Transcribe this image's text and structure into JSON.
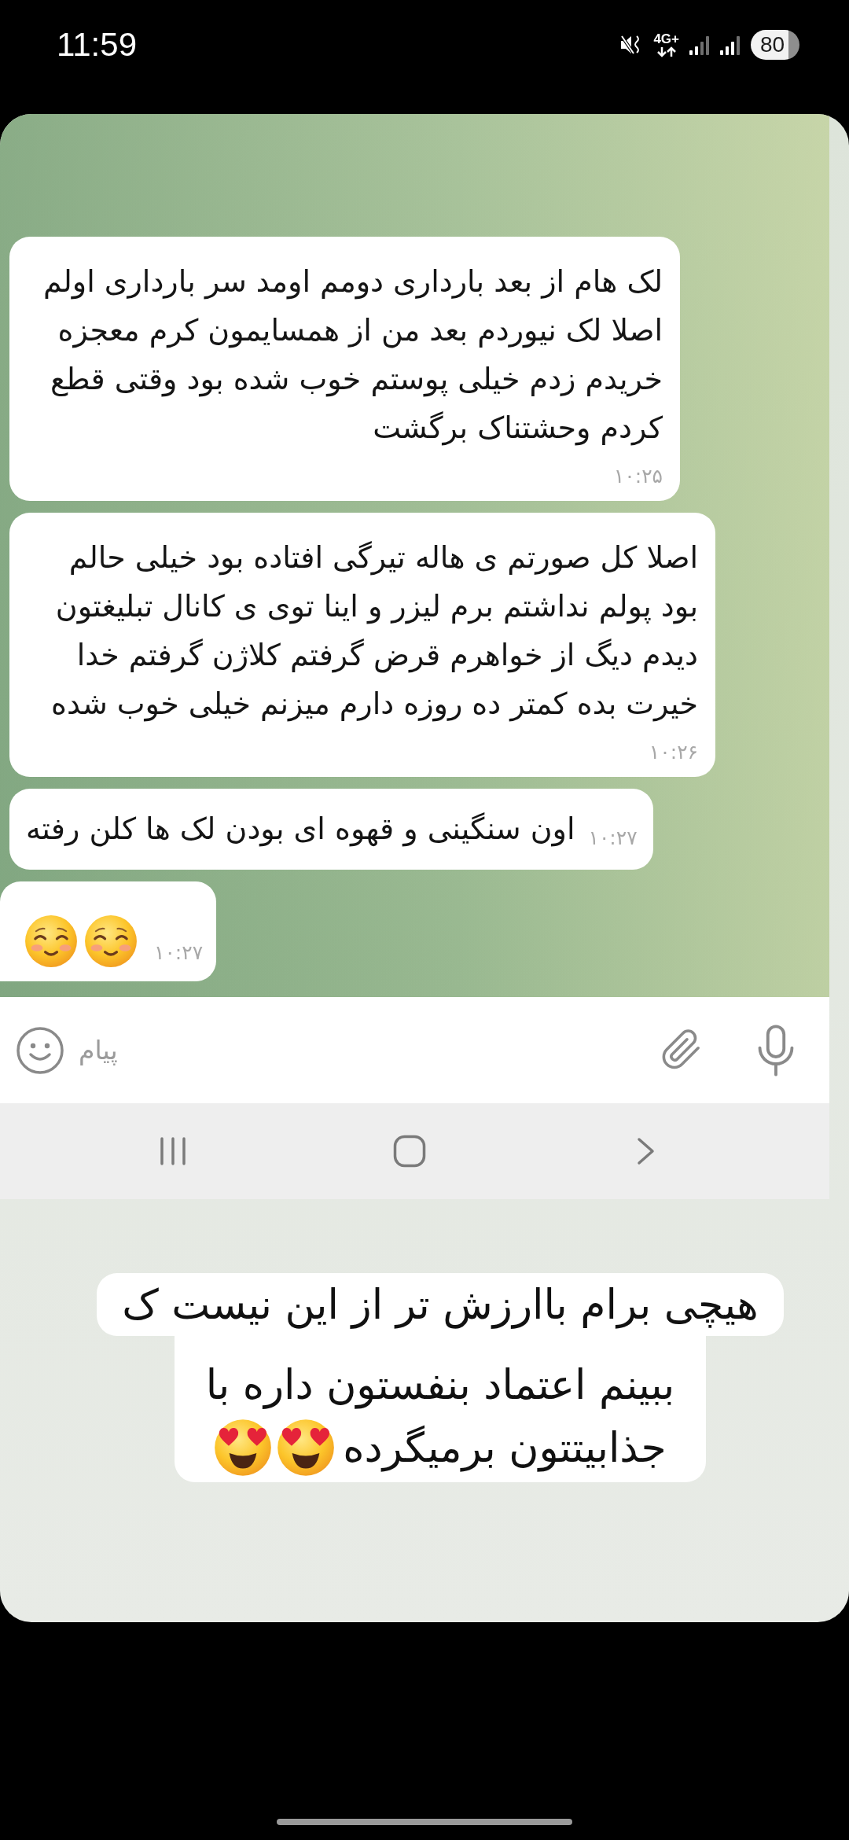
{
  "status_bar": {
    "time": "11:59",
    "network": "4G+",
    "battery": "80"
  },
  "chat": {
    "messages": [
      {
        "kind": "text",
        "text": "لک هام از بعد بارداری دومم اومد سر بارداری اولم اصلا لک نیوردم بعد من از همسایمون کرم معجزه خریدم زدم خیلی پوستم خوب شده بود وقتی قطع کردم وحشتناک برگشت",
        "time": "۱۰:۲۵",
        "tail": false
      },
      {
        "kind": "text",
        "text": "اصلا کل صورتم ی هاله تیرگی افتاده بود خیلی حالم بود پولم نداشتم برم لیزر و اینا توی ی کانال تبلیغتون دیدم دیگ از خواهرم قرض گرفتم کلاژن گرفتم خدا خیرت بده کمتر ده روزه دارم میزنم خیلی خوب شده",
        "time": "۱۰:۲۶",
        "tail": false
      },
      {
        "kind": "inline",
        "text": "اون سنگینی و قهوه ای بودن لک ها کلن رفته",
        "time": "۱۰:۲۷",
        "tail": false
      },
      {
        "kind": "emoji",
        "emojis": [
          {
            "kind": "smiling-face"
          },
          {
            "kind": "smiling-face"
          }
        ],
        "time": "۱۰:۲۷",
        "tail": true
      }
    ]
  },
  "composer": {
    "placeholder": "پیام"
  },
  "caption": {
    "lines": [
      "هیچی برام باارزش تر از این نیست ک",
      "ببینم اعتماد بنفستون داره با",
      "جذابیتتون برمیگرده"
    ],
    "emojis": [
      {
        "kind": "heart-eyes"
      },
      {
        "kind": "heart-eyes"
      }
    ]
  }
}
